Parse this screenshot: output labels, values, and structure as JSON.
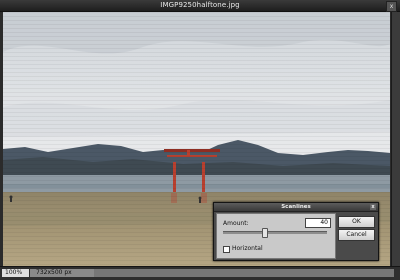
{
  "window": {
    "title": "IMGP9250halftone.jpg",
    "close_glyph": "x"
  },
  "status": {
    "zoom": "100%",
    "image_size": "732x500 px"
  },
  "dialog": {
    "title": "Scanlines",
    "close_glyph": "x",
    "amount_label": "Amount:",
    "amount_value": "40",
    "amount_level": 0.4,
    "horizontal_label": "Horizontal",
    "horizontal_checked": false,
    "ok_label": "OK",
    "cancel_label": "Cancel"
  }
}
